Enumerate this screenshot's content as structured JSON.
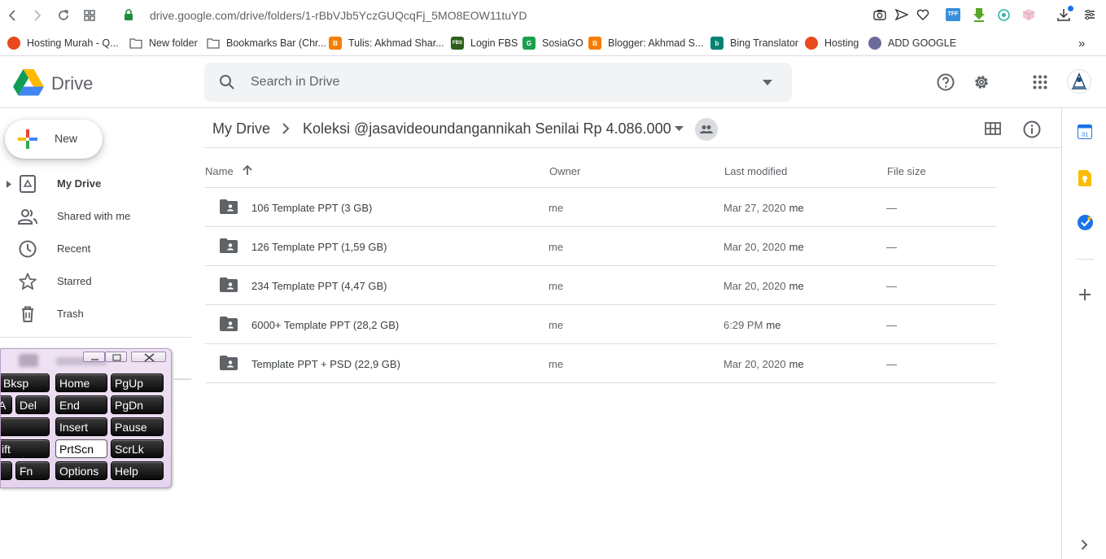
{
  "browser": {
    "url_host": "drive.google.com",
    "url_path": "/drive/folders/1-rBbVJb5YczGUQcqFj_5MO8EOW11tuYD",
    "bookmarks": [
      {
        "label": "Hosting Murah - Q...",
        "icon": "hosting-icon",
        "color": "#e8491d"
      },
      {
        "label": "New folder",
        "icon": "folder-icon",
        "color": "#5f6368"
      },
      {
        "label": "Bookmarks Bar (Chr...",
        "icon": "folder-icon",
        "color": "#5f6368"
      },
      {
        "label": "Tulis: Akhmad Shar...",
        "icon": "blogger-icon",
        "color": "#f57d00"
      },
      {
        "label": "Login FBS",
        "icon": "fbs-icon",
        "color": "#2e5e1e"
      },
      {
        "label": "SosiaGO",
        "icon": "sosiago-icon",
        "color": "#1aa14b"
      },
      {
        "label": "Blogger: Akhmad S...",
        "icon": "blogger-icon",
        "color": "#f57d00"
      },
      {
        "label": "Bing Translator",
        "icon": "bing-icon",
        "color": "#008373"
      },
      {
        "label": "Hosting",
        "icon": "hosting-icon",
        "color": "#e8491d"
      },
      {
        "label": "ADD GOOGLE",
        "icon": "add-google-icon",
        "color": "#6b6b9a"
      }
    ],
    "bookmarks_overflow": "»"
  },
  "drive": {
    "product_name": "Drive",
    "search_placeholder": "Search in Drive",
    "new_button": "New",
    "nav": [
      {
        "label": "My Drive",
        "icon": "my-drive-icon"
      },
      {
        "label": "Shared with me",
        "icon": "shared-icon"
      },
      {
        "label": "Recent",
        "icon": "clock-icon"
      },
      {
        "label": "Starred",
        "icon": "star-icon"
      },
      {
        "label": "Trash",
        "icon": "trash-icon"
      }
    ],
    "breadcrumb": {
      "root": "My Drive",
      "current": "Koleksi @jasavideoundangannikah Senilai Rp 4.086.000"
    },
    "columns": {
      "name": "Name",
      "owner": "Owner",
      "last_modified": "Last modified",
      "file_size": "File size"
    },
    "files": [
      {
        "name": "106 Template PPT (3 GB)",
        "owner": "me",
        "modified": "Mar 27, 2020",
        "modified_by": "me",
        "size": "—"
      },
      {
        "name": "126 Template PPT (1,59 GB)",
        "owner": "me",
        "modified": "Mar 20, 2020",
        "modified_by": "me",
        "size": "—"
      },
      {
        "name": "234 Template PPT (4,47 GB)",
        "owner": "me",
        "modified": "Mar 20, 2020",
        "modified_by": "me",
        "size": "—"
      },
      {
        "name": "6000+ Template PPT (28,2 GB)",
        "owner": "me",
        "modified": "6:29 PM",
        "modified_by": "me",
        "size": "—"
      },
      {
        "name": "Template PPT + PSD (22,9 GB)",
        "owner": "me",
        "modified": "Mar 20, 2020",
        "modified_by": "me",
        "size": "—"
      }
    ]
  },
  "keyboard": {
    "keys": [
      {
        "row": 0,
        "col": 0,
        "label": "Bksp"
      },
      {
        "row": 0,
        "col": 1,
        "label": "Home"
      },
      {
        "row": 0,
        "col": 2,
        "label": "PgUp"
      },
      {
        "row": 1,
        "col": -1,
        "label": "A"
      },
      {
        "row": 1,
        "col": 0,
        "label": "Del"
      },
      {
        "row": 1,
        "col": 1,
        "label": "End"
      },
      {
        "row": 1,
        "col": 2,
        "label": "PgDn"
      },
      {
        "row": 2,
        "col": 0,
        "label": ""
      },
      {
        "row": 2,
        "col": 1,
        "label": "Insert"
      },
      {
        "row": 2,
        "col": 2,
        "label": "Pause"
      },
      {
        "row": 3,
        "col": 0,
        "label": "ift"
      },
      {
        "row": 3,
        "col": 1,
        "label": "PrtScn"
      },
      {
        "row": 3,
        "col": 2,
        "label": "ScrLk"
      },
      {
        "row": 4,
        "col": -1,
        "label": ""
      },
      {
        "row": 4,
        "col": 0,
        "label": "Fn"
      },
      {
        "row": 4,
        "col": 1,
        "label": "Options"
      },
      {
        "row": 4,
        "col": 2,
        "label": "Help"
      }
    ]
  },
  "colors": {
    "accent_blue": "#1a73e8",
    "text_primary": "#3c4043",
    "text_secondary": "#5f6368",
    "divider": "#dadce0"
  }
}
